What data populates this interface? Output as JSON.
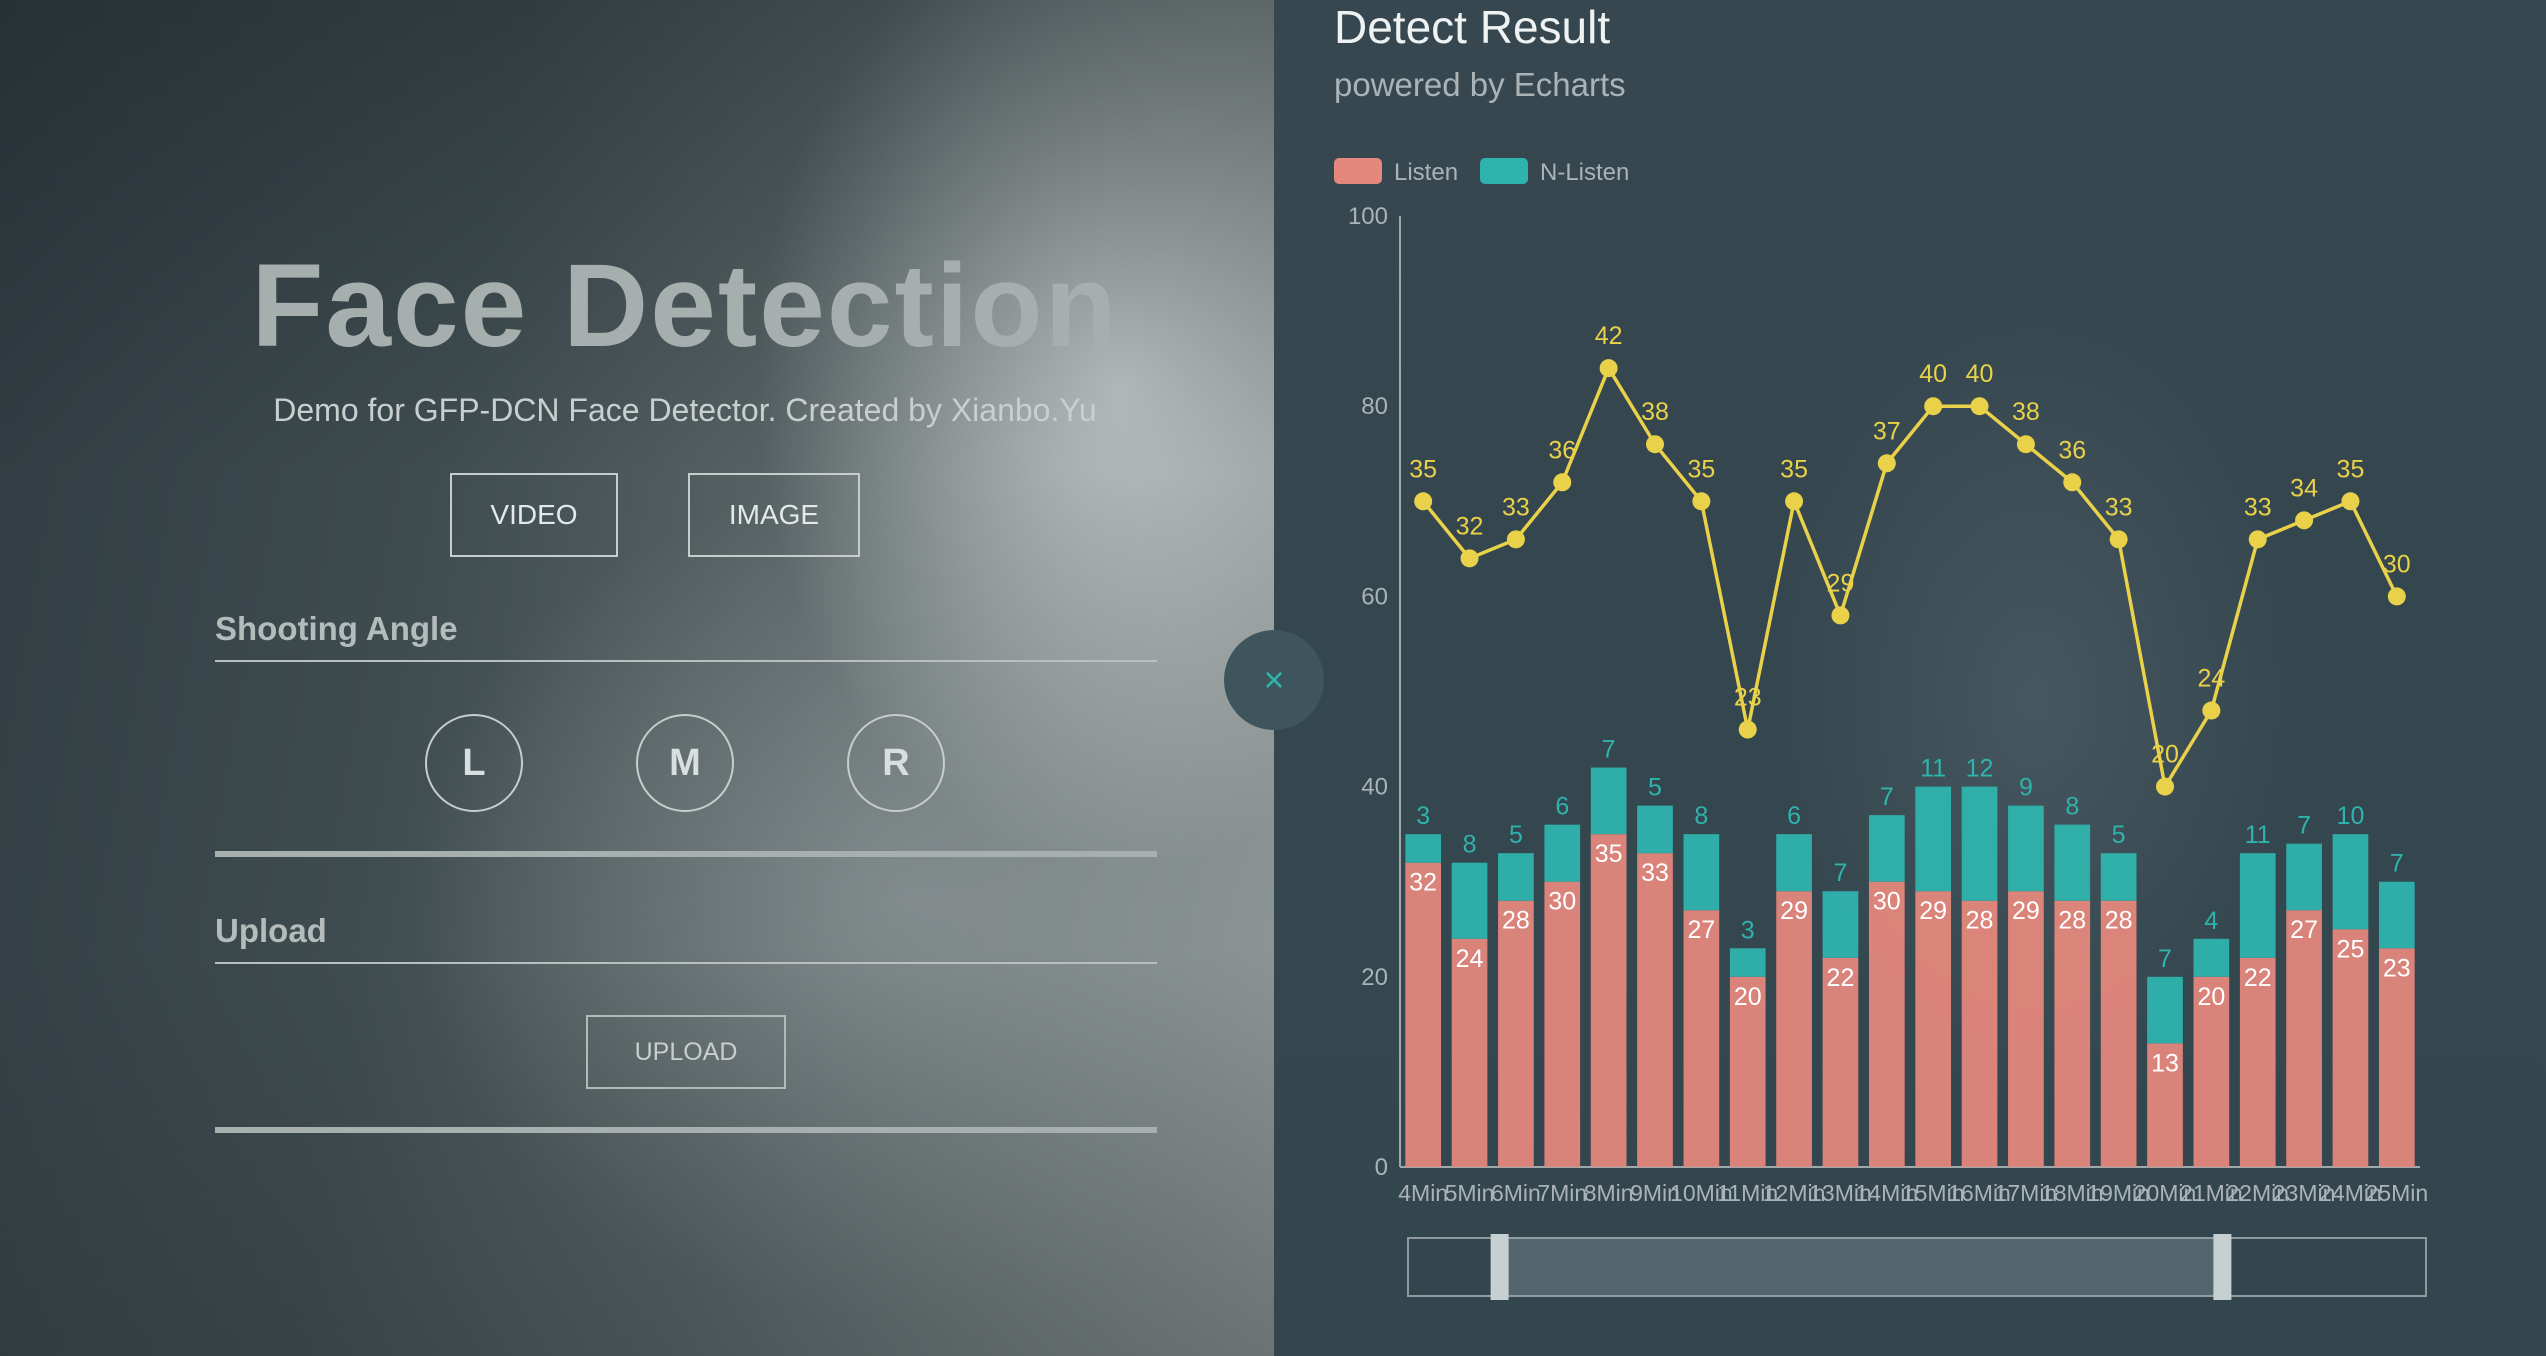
{
  "left_panel": {
    "title": "Face Detection",
    "subtitle": "Demo for GFP-DCN Face Detector. Created by Xianbo.Yu",
    "mode_buttons": {
      "video": "VIDEO",
      "image": "IMAGE"
    },
    "shooting_angle": {
      "label": "Shooting Angle",
      "options": [
        "L",
        "M",
        "R"
      ]
    },
    "upload": {
      "label": "Upload",
      "button": "UPLOAD"
    }
  },
  "toggle": {
    "icon": "close-icon",
    "glyph": "×"
  },
  "right_panel": {
    "title": "Detect Result",
    "subtitle": "powered by Echarts"
  },
  "colors": {
    "listen": "#e4877c",
    "n_listen": "#2fb3ad",
    "line": "#e9d24a",
    "axis": "#9fa9ac"
  },
  "chart_data": {
    "type": "bar",
    "stacked": true,
    "legend": [
      "Listen",
      "N-Listen"
    ],
    "legend_position": "top-left",
    "categories": [
      "4Min",
      "5Min",
      "6Min",
      "7Min",
      "8Min",
      "9Min",
      "10Min",
      "11Min",
      "12Min",
      "13Min",
      "14Min",
      "15Min",
      "16Min",
      "17Min",
      "18Min",
      "19Min",
      "20Min",
      "21Min",
      "22Min",
      "23Min",
      "24Min",
      "25Min"
    ],
    "series": [
      {
        "name": "Listen",
        "type": "bar",
        "values": [
          32,
          24,
          28,
          30,
          35,
          33,
          27,
          20,
          29,
          22,
          30,
          29,
          28,
          29,
          28,
          28,
          13,
          20,
          22,
          27,
          25,
          23
        ]
      },
      {
        "name": "N-Listen",
        "type": "bar",
        "values": [
          3,
          8,
          5,
          6,
          7,
          5,
          8,
          3,
          6,
          7,
          7,
          11,
          12,
          9,
          8,
          5,
          7,
          4,
          11,
          7,
          10,
          7
        ]
      },
      {
        "type": "line",
        "values": [
          35,
          32,
          33,
          36,
          42,
          38,
          35,
          23,
          35,
          29,
          37,
          40,
          40,
          38,
          36,
          33,
          20,
          24,
          33,
          34,
          35,
          30
        ]
      }
    ],
    "y_ticks": [
      0,
      20,
      40,
      60,
      80,
      100
    ],
    "ylim": [
      0,
      100
    ],
    "data_zoom": {
      "start": 0.09,
      "end": 0.8
    }
  }
}
